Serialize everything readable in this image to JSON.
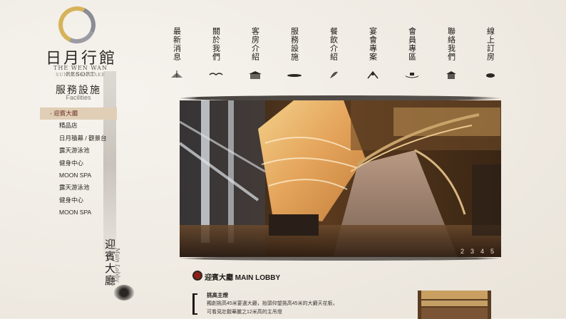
{
  "brand": {
    "name_cn": "日月行館",
    "name_en": "THE WEN WAN RESORT",
    "location_en": "SUN MOON LAKE"
  },
  "section": {
    "title": "服務設施",
    "subtitle": "Facilities",
    "vertical_title": "迎賓大廳",
    "vertical_subtitle": "Main Lobby"
  },
  "nav": [
    {
      "label": "最新消息",
      "icon": "lotus-icon"
    },
    {
      "label": "關於我們",
      "icon": "bird-icon"
    },
    {
      "label": "客房介紹",
      "icon": "house-icon"
    },
    {
      "label": "服務設施",
      "icon": "brush-stroke-icon"
    },
    {
      "label": "餐飲介紹",
      "icon": "leaf-icon"
    },
    {
      "label": "宴會專案",
      "icon": "flower-icon"
    },
    {
      "label": "會員專區",
      "icon": "boat-icon"
    },
    {
      "label": "聯絡我們",
      "icon": "pavilion-icon"
    },
    {
      "label": "線上訂房",
      "icon": "ink-dot-icon"
    }
  ],
  "menu": [
    {
      "label": "迎賓大廳",
      "active": true
    },
    {
      "label": "精品店",
      "active": false
    },
    {
      "label": "日月積幕 / 觀景台",
      "active": false
    },
    {
      "label": "露天游泳池",
      "active": false
    },
    {
      "label": "健身中心",
      "active": false
    },
    {
      "label": "MOON SPA",
      "active": false
    },
    {
      "label": "露天游泳池",
      "active": false
    },
    {
      "label": "健身中心",
      "active": false
    },
    {
      "label": "MOON SPA",
      "active": false
    }
  ],
  "hero": {
    "pages": [
      "2",
      "3",
      "4",
      "5"
    ]
  },
  "content": {
    "title": "迎賓大廳 MAIN LOBBY",
    "para_head": "挑高主燈",
    "para_line1": "獨創挑高45米宴選大廳，抬頭仰望挑高45米的大廳天花板，",
    "para_line2": "可看見壯觀華麗之12米高的主吊燈"
  },
  "colors": {
    "background": "#f1ede6",
    "accent_red": "#8f1f15",
    "active_menu": "#e0cfb6",
    "gold": "#d6b25a"
  }
}
